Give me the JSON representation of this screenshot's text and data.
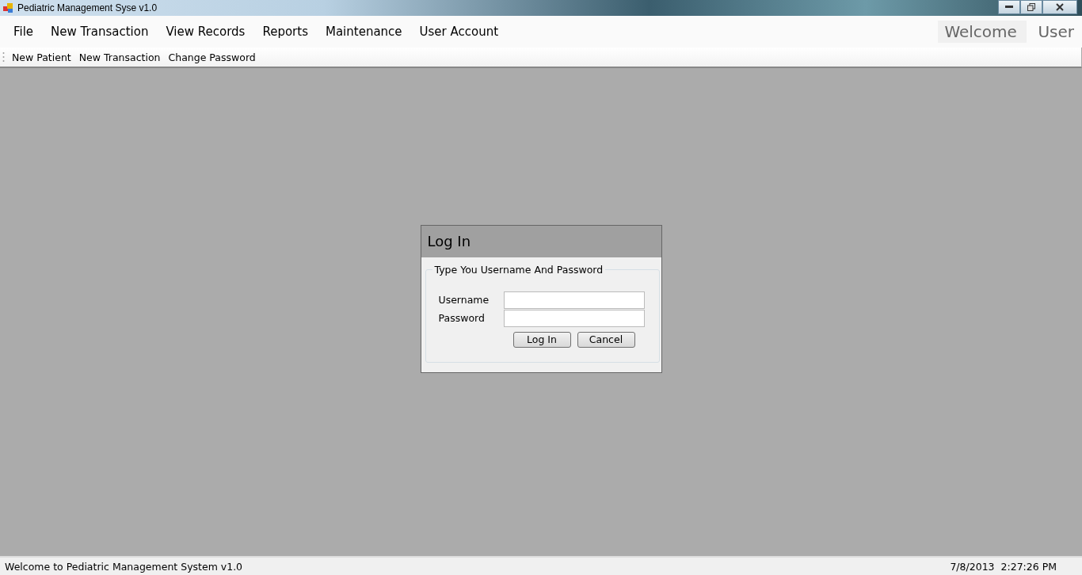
{
  "window": {
    "title": "Pediatric Management Syse v1.0"
  },
  "menu": [
    {
      "label": "File"
    },
    {
      "label": "New Transaction"
    },
    {
      "label": "View Records"
    },
    {
      "label": "Reports"
    },
    {
      "label": "Maintenance"
    },
    {
      "label": "User Account"
    }
  ],
  "user_panel": {
    "greeting": "Welcome",
    "user": "User"
  },
  "toolbar": [
    {
      "label": "New Patient"
    },
    {
      "label": "New Transaction"
    },
    {
      "label": "Change Password"
    }
  ],
  "dialog": {
    "title": "Log In",
    "group_label": "Type You Username And Password",
    "fields": [
      {
        "label": "Username"
      },
      {
        "label": "Password"
      }
    ],
    "buttons": [
      {
        "label": "Log In"
      },
      {
        "label": "Cancel"
      }
    ]
  },
  "status_bar": {
    "message": "Welcome to Pediatric Management System v1.0",
    "datetime": "7/8/2013  2:27:26 PM"
  }
}
